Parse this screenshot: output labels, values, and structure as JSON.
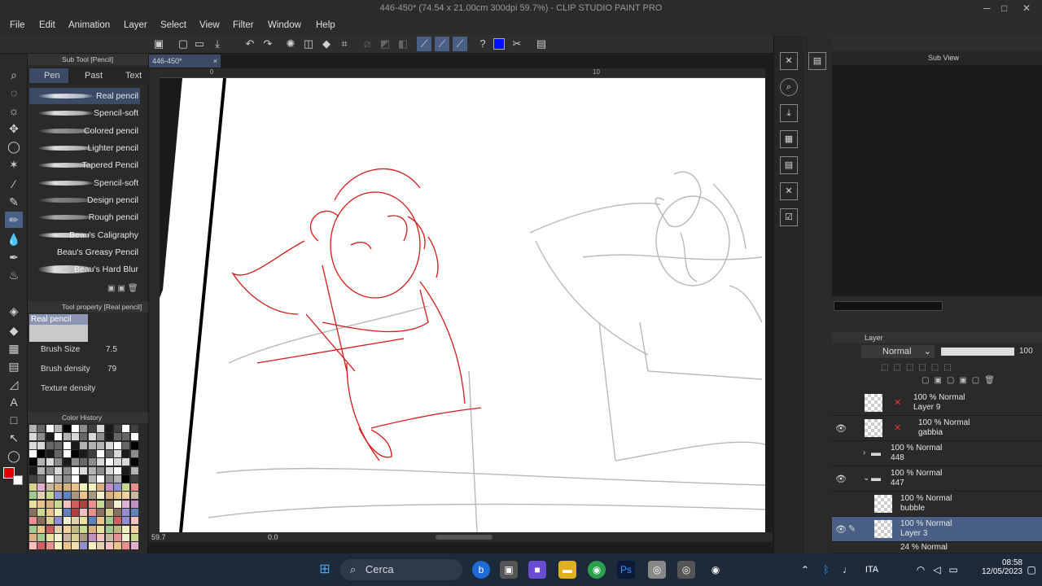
{
  "app": {
    "title": "446-450* (74.54 x 21.00cm 300dpi 59.7%) - CLIP STUDIO PAINT PRO"
  },
  "menu": [
    "File",
    "Edit",
    "Animation",
    "Layer",
    "Select",
    "View",
    "Filter",
    "Window",
    "Help"
  ],
  "subtool": {
    "header": "Sub Tool [Pencil]",
    "tabs": [
      "Pen",
      "Past",
      "Text"
    ],
    "brushes": [
      "Real pencil",
      "Spencil-soft",
      "Colored pencil",
      "Lighter pencil",
      "Tapered Pencil",
      "Spencil-soft",
      "Design pencil",
      "Rough pencil",
      "Beau's Caligraphy",
      "Beau's Greasy Pencil",
      "Beau's Hard Blur"
    ]
  },
  "toolprop": {
    "header": "Tool property [Real pencil]",
    "preview_label": "Real pencil",
    "brush_size_label": "Brush Size",
    "brush_size_value": "7.5",
    "brush_density_label": "Brush density",
    "brush_density_value": "79",
    "texture_density_label": "Texture density"
  },
  "colorhistory": {
    "header": "Color History"
  },
  "canvas": {
    "tab_label": "446-450*",
    "zoom": "59.7",
    "rotation": "0.0",
    "ruler_marks": [
      "0",
      "10"
    ]
  },
  "subview": {
    "label": "Sub View"
  },
  "layers": {
    "header": "Layer",
    "blend_mode": "Normal",
    "opacity": "100",
    "items": [
      {
        "line1": "100 % Normal",
        "line2": "Layer 9"
      },
      {
        "line1": "100 % Normal",
        "line2": "gabbia"
      },
      {
        "line1": "100 % Normal",
        "line2": "448"
      },
      {
        "line1": "100 % Normal",
        "line2": "447"
      },
      {
        "line1": "100 % Normal",
        "line2": "bubble"
      },
      {
        "line1": "100 % Normal",
        "line2": "Layer 3"
      },
      {
        "line1": "24 % Normal",
        "line2": ""
      }
    ]
  },
  "taskbar": {
    "search": "Cerca",
    "lang": "ITA",
    "time": "08:58",
    "date": "12/05/2023"
  },
  "colors": {
    "accent": "#4a5f86",
    "main_color": "#e00000",
    "sketch_red": "#d41a1a",
    "sketch_gray": "#b8b8b8"
  }
}
